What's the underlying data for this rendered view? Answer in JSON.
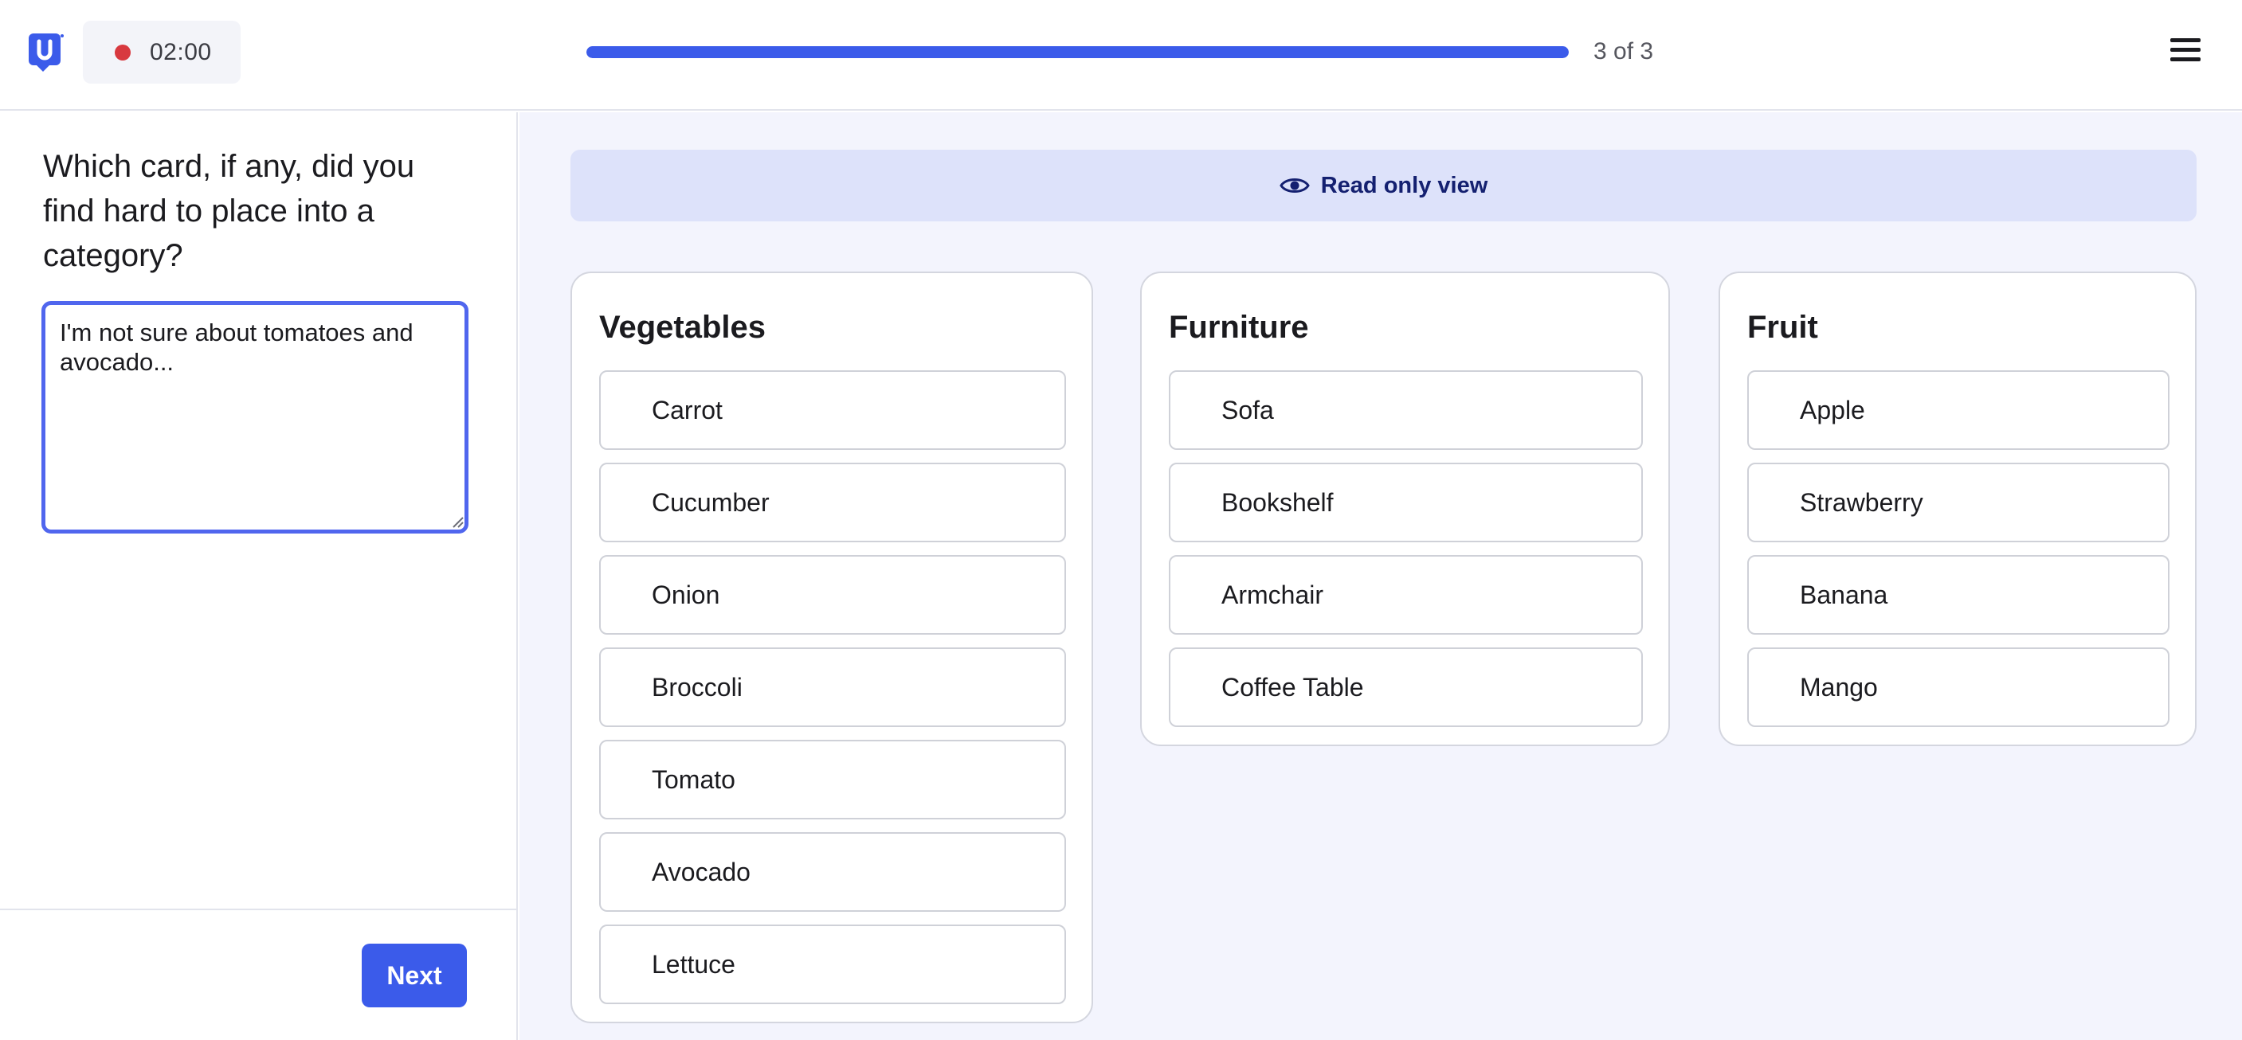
{
  "header": {
    "timer": "02:00",
    "progress_label": "3 of 3",
    "progress_fraction": 1.0,
    "accent_color": "#3b5bea",
    "record_color": "#d8393f",
    "logo_letter": "U"
  },
  "left": {
    "question": "Which card, if any, did you find hard to place into a category?",
    "answer": "I'm not sure about tomatoes and avocado...",
    "next_label": "Next"
  },
  "banner": {
    "text": "Read only view",
    "icon": "eye-icon"
  },
  "categories": [
    {
      "title": "Vegetables",
      "cards": [
        "Carrot",
        "Cucumber",
        "Onion",
        "Broccoli",
        "Tomato",
        "Avocado",
        "Lettuce"
      ]
    },
    {
      "title": "Furniture",
      "cards": [
        "Sofa",
        "Bookshelf",
        "Armchair",
        "Coffee Table"
      ]
    },
    {
      "title": "Fruit",
      "cards": [
        "Apple",
        "Strawberry",
        "Banana",
        "Mango"
      ]
    }
  ]
}
